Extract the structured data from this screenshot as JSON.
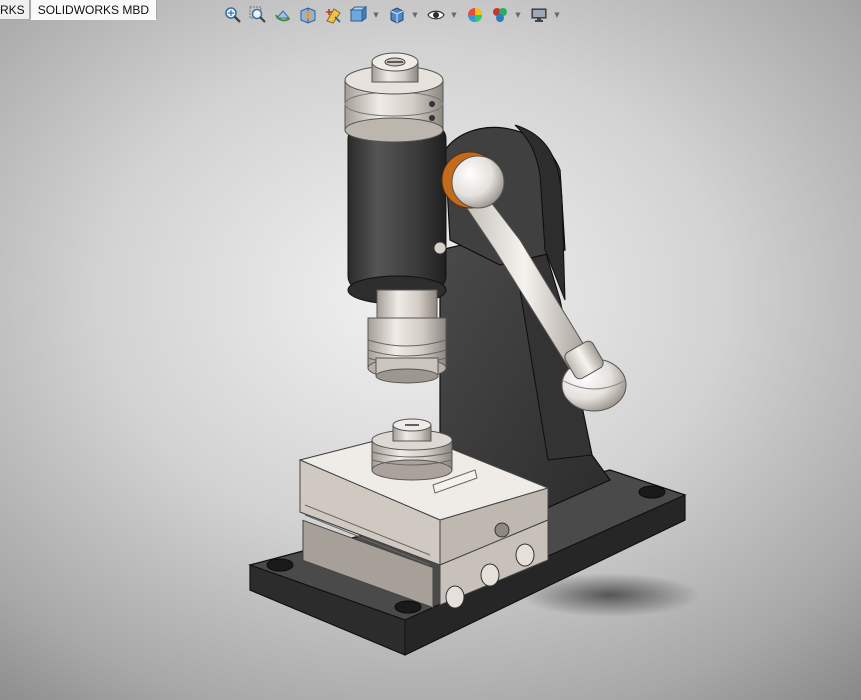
{
  "tabs": [
    {
      "label": "RKS"
    },
    {
      "label": "SOLIDWORKS MBD"
    }
  ],
  "toolbar": {
    "icons": [
      "zoom-to-fit-icon",
      "zoom-to-area-icon",
      "previous-view-icon",
      "section-view-icon",
      "dynamic-annotation-icon",
      "view-orientation-icon",
      "display-style-icon",
      "hide-show-items-icon",
      "edit-appearance-icon",
      "apply-scene-icon",
      "view-settings-icon"
    ]
  },
  "colors": {
    "frame": "#3f3f3f",
    "metal": "#d8d3cd",
    "bearing": "#c46a1d",
    "background_center": "#f2f2f2",
    "background_edge": "#5f5f5f"
  }
}
